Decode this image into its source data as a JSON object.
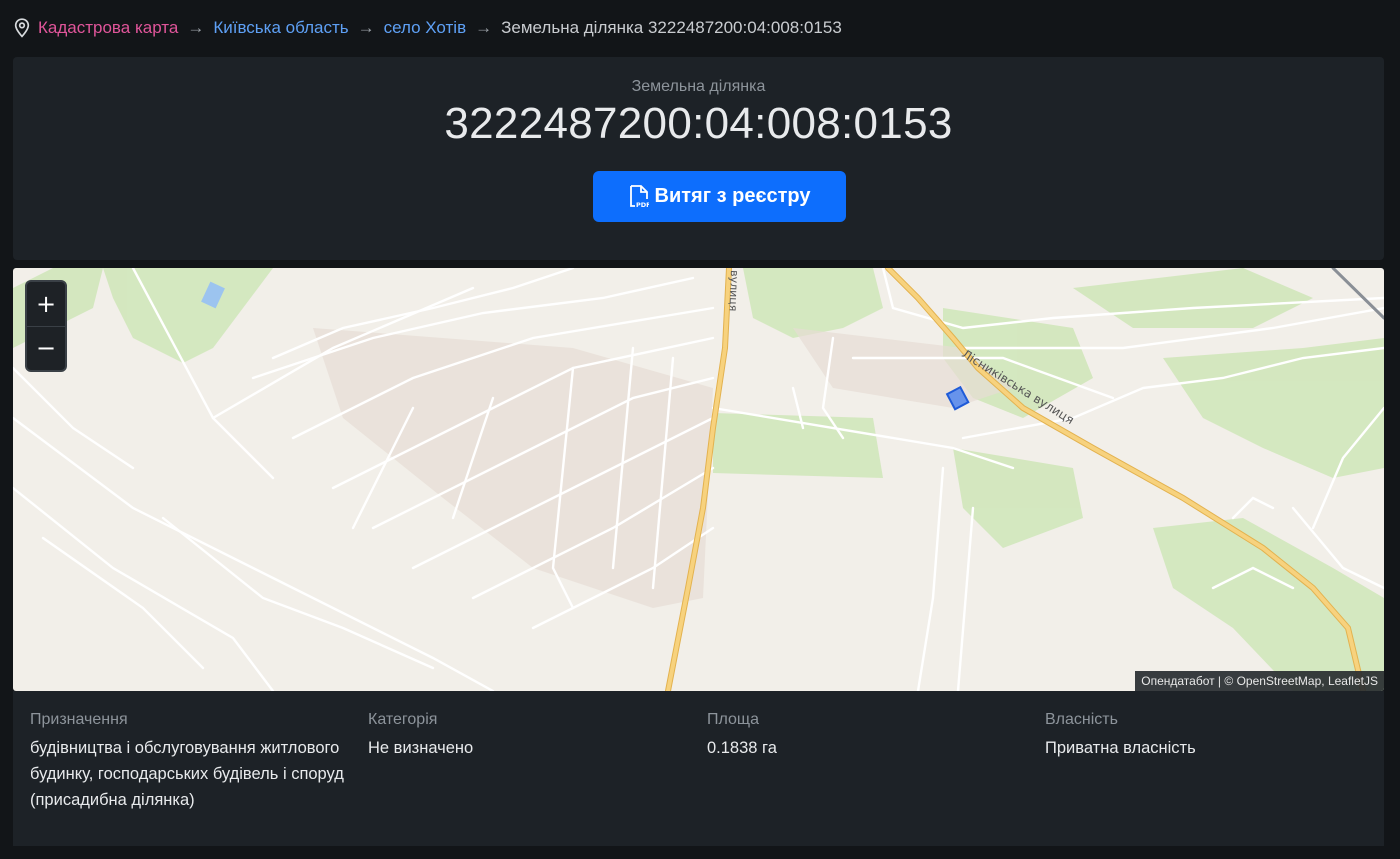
{
  "breadcrumb": {
    "items": [
      {
        "label": "Кадастрова карта"
      },
      {
        "label": "Київська область"
      },
      {
        "label": "село Хотів"
      }
    ],
    "current": "Земельна ділянка 3222487200:04:008:0153",
    "separator": "→"
  },
  "header": {
    "subtitle": "Земельна ділянка",
    "title": "3222487200:04:008:0153",
    "button_label": "Витяг з реєстру"
  },
  "map": {
    "zoom_in": "+",
    "zoom_out": "−",
    "street_label": "Лісниківська вулиця",
    "road_label": "вулиця",
    "attribution": {
      "source": "Опендатабот",
      "separator": " | © ",
      "osm": "OpenStreetMap",
      "comma": ", ",
      "leaflet": "LeafletJS"
    },
    "colors": {
      "background": "#f2efe9",
      "green": "#cfe6b8",
      "road_major": "#f7c86a",
      "parcel": "#2f6ff0"
    }
  },
  "info": {
    "purpose_label": "Призначення",
    "purpose_value": "будівництва і обслуговування житлового будинку, господарських будівель і споруд (присадибна ділянка)",
    "category_label": "Категорія",
    "category_value": "Не визначено",
    "area_label": "Площа",
    "area_value": "0.1838 га",
    "ownership_label": "Власність",
    "ownership_value": "Приватна власність"
  },
  "colors": {
    "background": "#121518",
    "card": "#1d2227",
    "accent": "#0d6efd",
    "crumb_pink": "#e0559a",
    "crumb_blue": "#5ea0f5"
  }
}
